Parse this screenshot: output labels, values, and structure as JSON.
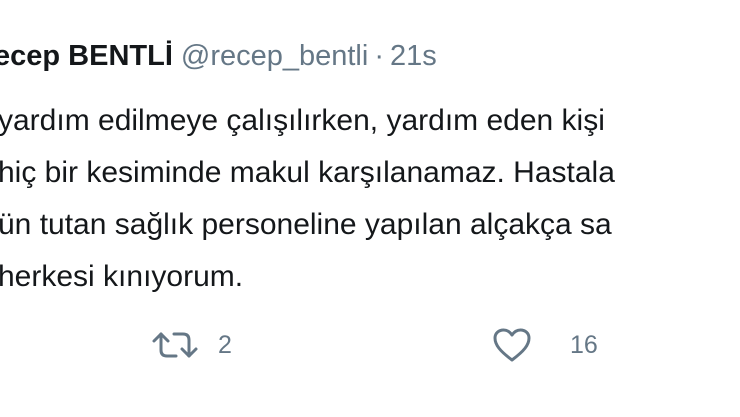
{
  "tweet": {
    "author_name": "ecep BENTLİ",
    "author_handle": "@recep_bentli",
    "separator": "·",
    "timestamp": "21s",
    "text_lines": [
      "yardım edilmeye çalışılırken, yardım eden kişi",
      "hiç bir kesiminde makul karşılanamaz. Hastala",
      "ün tutan sağlık personeline yapılan alçakça sa",
      "herkesi kınıyorum."
    ],
    "actions": {
      "retweet": {
        "icon": "retweet-icon",
        "count": "2"
      },
      "like": {
        "icon": "heart-icon",
        "count": "16"
      }
    }
  },
  "colors": {
    "text_primary": "#14171a",
    "text_secondary": "#657786",
    "background": "#ffffff"
  }
}
